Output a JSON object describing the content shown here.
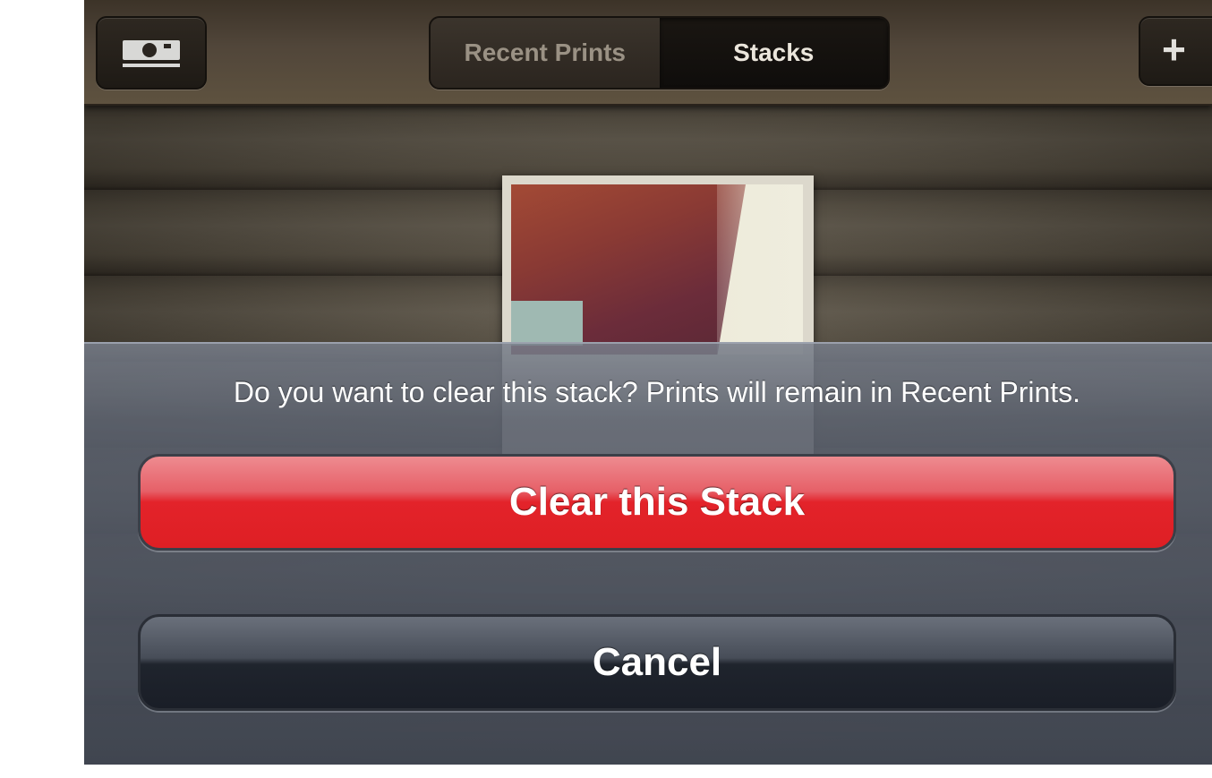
{
  "navbar": {
    "camera_icon": "camera-icon",
    "add_label": "+",
    "tabs": [
      {
        "label": "Recent Prints",
        "selected": false
      },
      {
        "label": "Stacks",
        "selected": true
      }
    ]
  },
  "action_sheet": {
    "message": "Do you want to clear this stack? Prints will remain in Recent Prints.",
    "destructive_label": "Clear this Stack",
    "cancel_label": "Cancel"
  },
  "colors": {
    "destructive": "#e3232a",
    "navbar": "#51463a",
    "sheet": "#5c626e"
  }
}
